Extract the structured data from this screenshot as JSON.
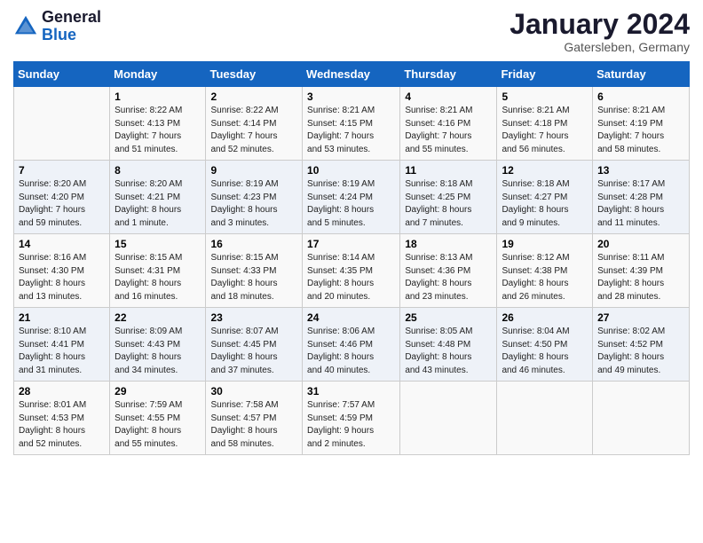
{
  "header": {
    "logo_line1": "General",
    "logo_line2": "Blue",
    "month": "January 2024",
    "location": "Gatersleben, Germany"
  },
  "weekdays": [
    "Sunday",
    "Monday",
    "Tuesday",
    "Wednesday",
    "Thursday",
    "Friday",
    "Saturday"
  ],
  "weeks": [
    [
      {
        "num": "",
        "info": ""
      },
      {
        "num": "1",
        "info": "Sunrise: 8:22 AM\nSunset: 4:13 PM\nDaylight: 7 hours\nand 51 minutes."
      },
      {
        "num": "2",
        "info": "Sunrise: 8:22 AM\nSunset: 4:14 PM\nDaylight: 7 hours\nand 52 minutes."
      },
      {
        "num": "3",
        "info": "Sunrise: 8:21 AM\nSunset: 4:15 PM\nDaylight: 7 hours\nand 53 minutes."
      },
      {
        "num": "4",
        "info": "Sunrise: 8:21 AM\nSunset: 4:16 PM\nDaylight: 7 hours\nand 55 minutes."
      },
      {
        "num": "5",
        "info": "Sunrise: 8:21 AM\nSunset: 4:18 PM\nDaylight: 7 hours\nand 56 minutes."
      },
      {
        "num": "6",
        "info": "Sunrise: 8:21 AM\nSunset: 4:19 PM\nDaylight: 7 hours\nand 58 minutes."
      }
    ],
    [
      {
        "num": "7",
        "info": "Sunrise: 8:20 AM\nSunset: 4:20 PM\nDaylight: 7 hours\nand 59 minutes."
      },
      {
        "num": "8",
        "info": "Sunrise: 8:20 AM\nSunset: 4:21 PM\nDaylight: 8 hours\nand 1 minute."
      },
      {
        "num": "9",
        "info": "Sunrise: 8:19 AM\nSunset: 4:23 PM\nDaylight: 8 hours\nand 3 minutes."
      },
      {
        "num": "10",
        "info": "Sunrise: 8:19 AM\nSunset: 4:24 PM\nDaylight: 8 hours\nand 5 minutes."
      },
      {
        "num": "11",
        "info": "Sunrise: 8:18 AM\nSunset: 4:25 PM\nDaylight: 8 hours\nand 7 minutes."
      },
      {
        "num": "12",
        "info": "Sunrise: 8:18 AM\nSunset: 4:27 PM\nDaylight: 8 hours\nand 9 minutes."
      },
      {
        "num": "13",
        "info": "Sunrise: 8:17 AM\nSunset: 4:28 PM\nDaylight: 8 hours\nand 11 minutes."
      }
    ],
    [
      {
        "num": "14",
        "info": "Sunrise: 8:16 AM\nSunset: 4:30 PM\nDaylight: 8 hours\nand 13 minutes."
      },
      {
        "num": "15",
        "info": "Sunrise: 8:15 AM\nSunset: 4:31 PM\nDaylight: 8 hours\nand 16 minutes."
      },
      {
        "num": "16",
        "info": "Sunrise: 8:15 AM\nSunset: 4:33 PM\nDaylight: 8 hours\nand 18 minutes."
      },
      {
        "num": "17",
        "info": "Sunrise: 8:14 AM\nSunset: 4:35 PM\nDaylight: 8 hours\nand 20 minutes."
      },
      {
        "num": "18",
        "info": "Sunrise: 8:13 AM\nSunset: 4:36 PM\nDaylight: 8 hours\nand 23 minutes."
      },
      {
        "num": "19",
        "info": "Sunrise: 8:12 AM\nSunset: 4:38 PM\nDaylight: 8 hours\nand 26 minutes."
      },
      {
        "num": "20",
        "info": "Sunrise: 8:11 AM\nSunset: 4:39 PM\nDaylight: 8 hours\nand 28 minutes."
      }
    ],
    [
      {
        "num": "21",
        "info": "Sunrise: 8:10 AM\nSunset: 4:41 PM\nDaylight: 8 hours\nand 31 minutes."
      },
      {
        "num": "22",
        "info": "Sunrise: 8:09 AM\nSunset: 4:43 PM\nDaylight: 8 hours\nand 34 minutes."
      },
      {
        "num": "23",
        "info": "Sunrise: 8:07 AM\nSunset: 4:45 PM\nDaylight: 8 hours\nand 37 minutes."
      },
      {
        "num": "24",
        "info": "Sunrise: 8:06 AM\nSunset: 4:46 PM\nDaylight: 8 hours\nand 40 minutes."
      },
      {
        "num": "25",
        "info": "Sunrise: 8:05 AM\nSunset: 4:48 PM\nDaylight: 8 hours\nand 43 minutes."
      },
      {
        "num": "26",
        "info": "Sunrise: 8:04 AM\nSunset: 4:50 PM\nDaylight: 8 hours\nand 46 minutes."
      },
      {
        "num": "27",
        "info": "Sunrise: 8:02 AM\nSunset: 4:52 PM\nDaylight: 8 hours\nand 49 minutes."
      }
    ],
    [
      {
        "num": "28",
        "info": "Sunrise: 8:01 AM\nSunset: 4:53 PM\nDaylight: 8 hours\nand 52 minutes."
      },
      {
        "num": "29",
        "info": "Sunrise: 7:59 AM\nSunset: 4:55 PM\nDaylight: 8 hours\nand 55 minutes."
      },
      {
        "num": "30",
        "info": "Sunrise: 7:58 AM\nSunset: 4:57 PM\nDaylight: 8 hours\nand 58 minutes."
      },
      {
        "num": "31",
        "info": "Sunrise: 7:57 AM\nSunset: 4:59 PM\nDaylight: 9 hours\nand 2 minutes."
      },
      {
        "num": "",
        "info": ""
      },
      {
        "num": "",
        "info": ""
      },
      {
        "num": "",
        "info": ""
      }
    ]
  ]
}
